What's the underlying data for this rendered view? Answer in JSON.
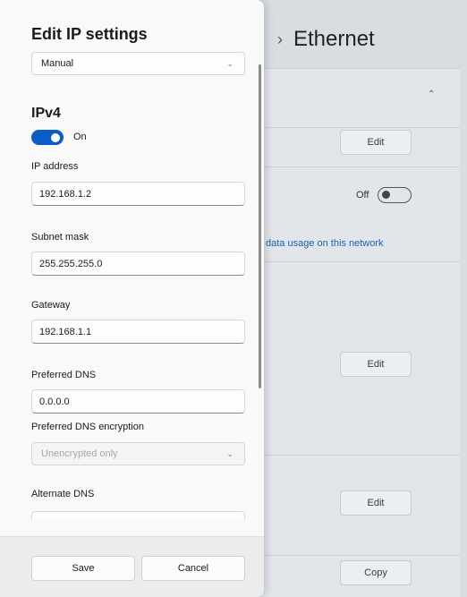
{
  "background": {
    "title": "Ethernet",
    "buttons": {
      "edit1": "Edit",
      "edit2": "Edit",
      "edit3": "Edit",
      "copy": "Copy"
    },
    "toggle_label": "Off",
    "link_text": "data usage on this network"
  },
  "dialog": {
    "title": "Edit IP settings",
    "mode_select": "Manual",
    "section_title": "IPv4",
    "ipv4_toggle": {
      "label": "On",
      "state": "on"
    },
    "fields": {
      "ip_address": {
        "label": "IP address",
        "value": "192.168.1.2"
      },
      "subnet_mask": {
        "label": "Subnet mask",
        "value": "255.255.255.0"
      },
      "gateway": {
        "label": "Gateway",
        "value": "192.168.1.1"
      },
      "preferred_dns": {
        "label": "Preferred DNS",
        "value": "0.0.0.0"
      },
      "preferred_dns_encryption": {
        "label": "Preferred DNS encryption",
        "value": "Unencrypted only"
      },
      "alternate_dns": {
        "label": "Alternate DNS",
        "value": ""
      }
    },
    "footer": {
      "save": "Save",
      "cancel": "Cancel"
    }
  },
  "colors": {
    "accent": "#0b5cc7",
    "link": "#1a5fb4"
  }
}
